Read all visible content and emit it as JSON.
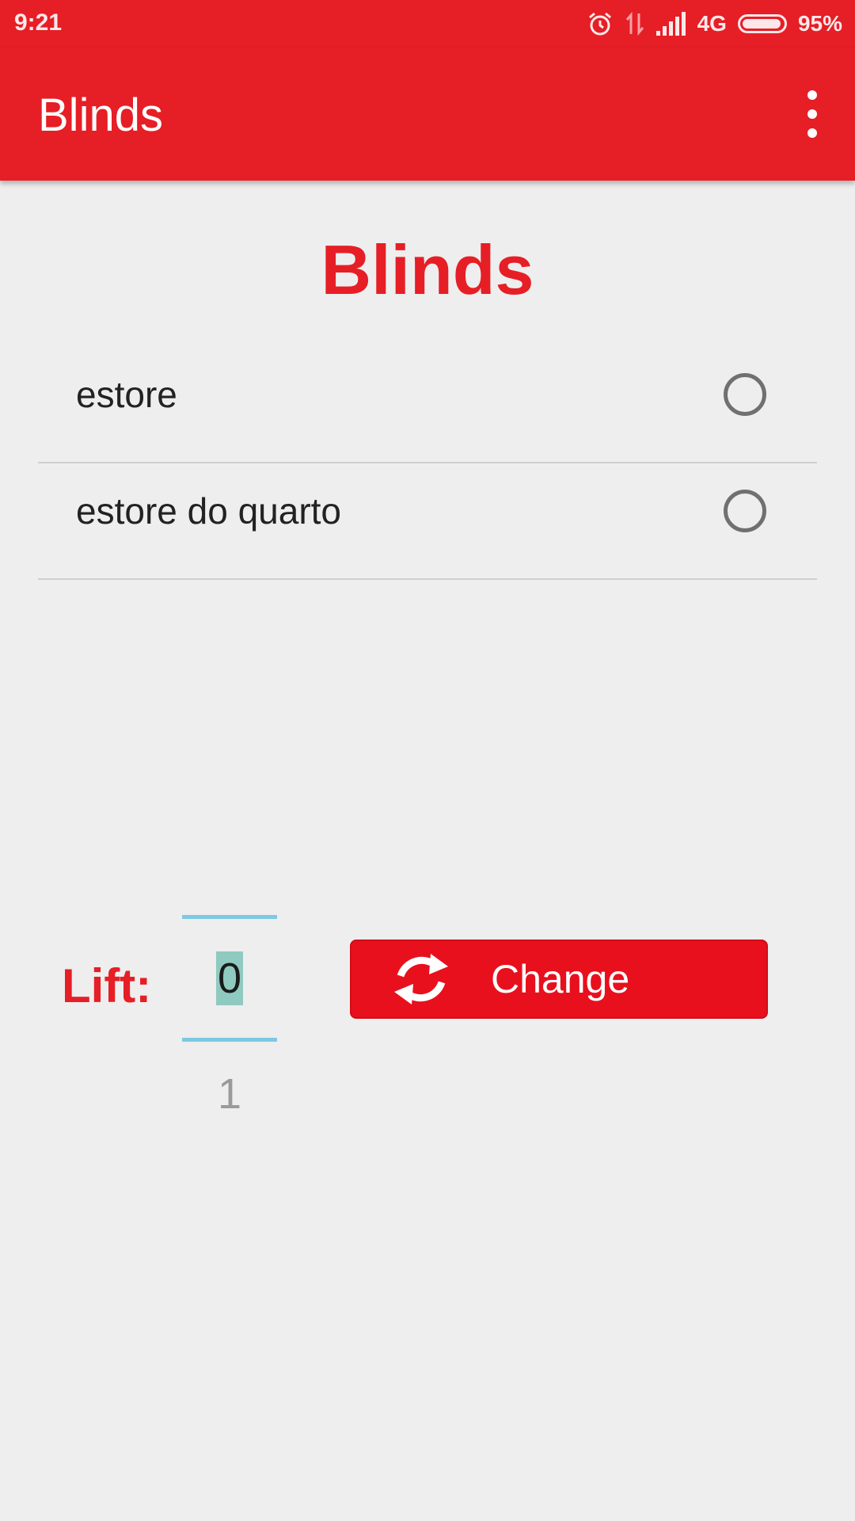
{
  "status_bar": {
    "time": "9:21",
    "network": "4G",
    "battery": "95%"
  },
  "app_bar": {
    "title": "Blinds"
  },
  "page": {
    "heading": "Blinds"
  },
  "blinds": [
    {
      "label": "estore",
      "selected": false
    },
    {
      "label": "estore do quarto",
      "selected": false
    }
  ],
  "lift": {
    "label": "Lift:",
    "current_value": "0",
    "next_value": "1"
  },
  "change_button": {
    "label": "Change"
  },
  "colors": {
    "accent": "#e61e26",
    "picker_divider": "#7ec8e3",
    "picker_highlight": "#8fcac0"
  }
}
